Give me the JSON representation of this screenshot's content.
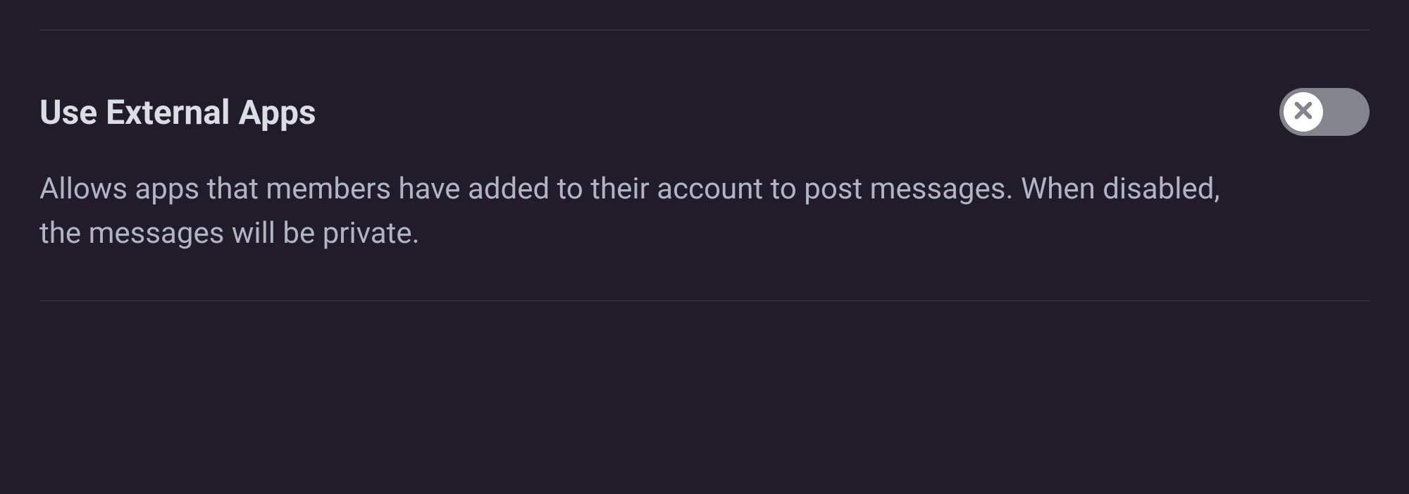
{
  "setting": {
    "title": "Use External Apps",
    "description": "Allows apps that members have added to their account to post messages. When disabled, the messages will be private.",
    "enabled": false
  }
}
